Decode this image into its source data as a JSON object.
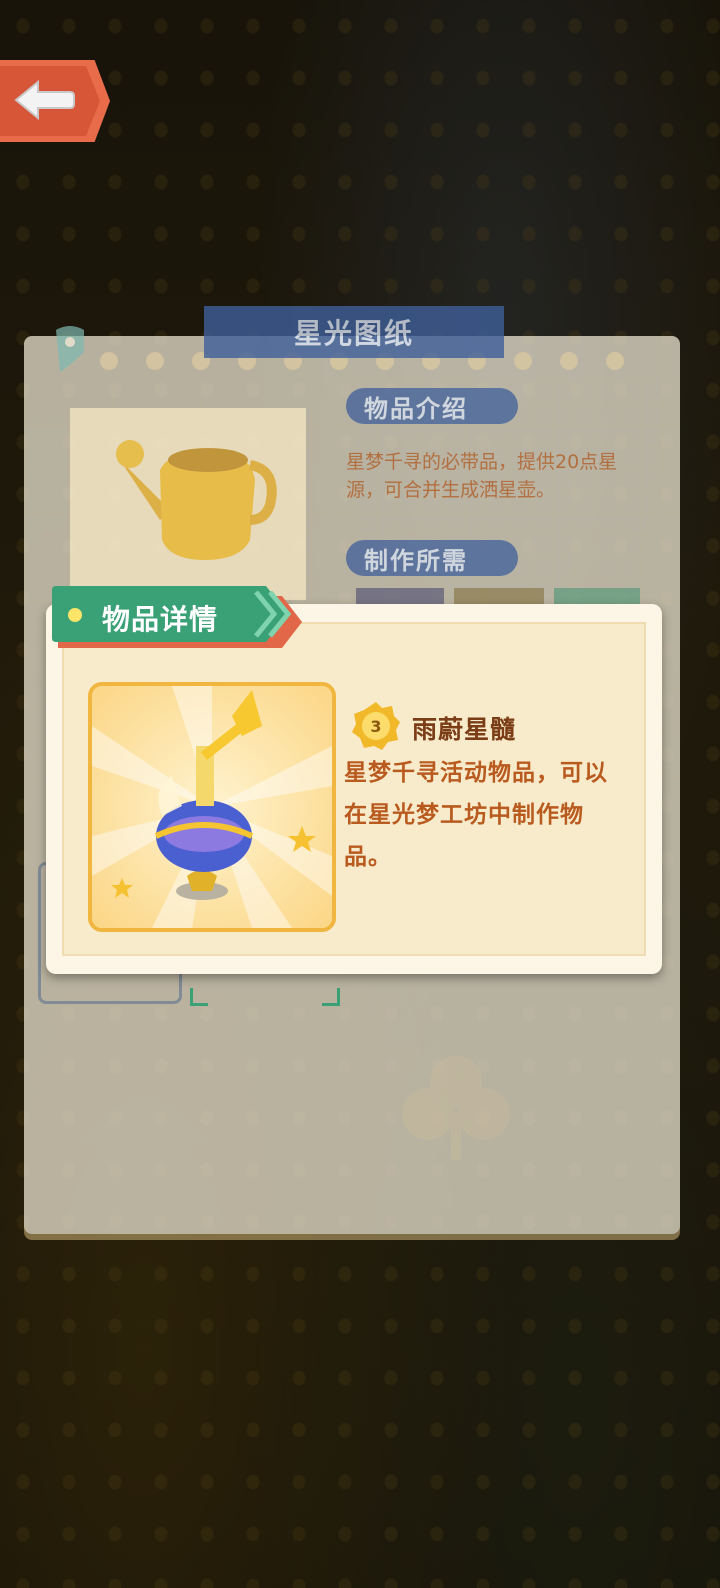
{
  "blueprint": {
    "title": "星光图纸",
    "intro_label": "物品介绍",
    "intro_text": "星梦千寻的必带品，提供20点星源，可合并生成洒星壶。",
    "requirements_label": "制作所需"
  },
  "detail_popup": {
    "tab_label": "物品详情",
    "item_level": "3",
    "item_name": "雨蔚星髓",
    "item_description": "星梦千寻活动物品，可以在星光梦工坊中制作物品。"
  },
  "icons": {
    "back": "back-arrow-icon",
    "item": "star-bottle-icon",
    "blueprint_item": "watering-can-icon",
    "level": "gold-coin-icon"
  },
  "colors": {
    "accent_red": "#e86b4a",
    "tab_green": "#3aa076",
    "title_blue": "#3f5f9a",
    "desc_text": "#b95a1f",
    "name_text": "#7a3d16",
    "frame_gold": "#f1b63f"
  }
}
